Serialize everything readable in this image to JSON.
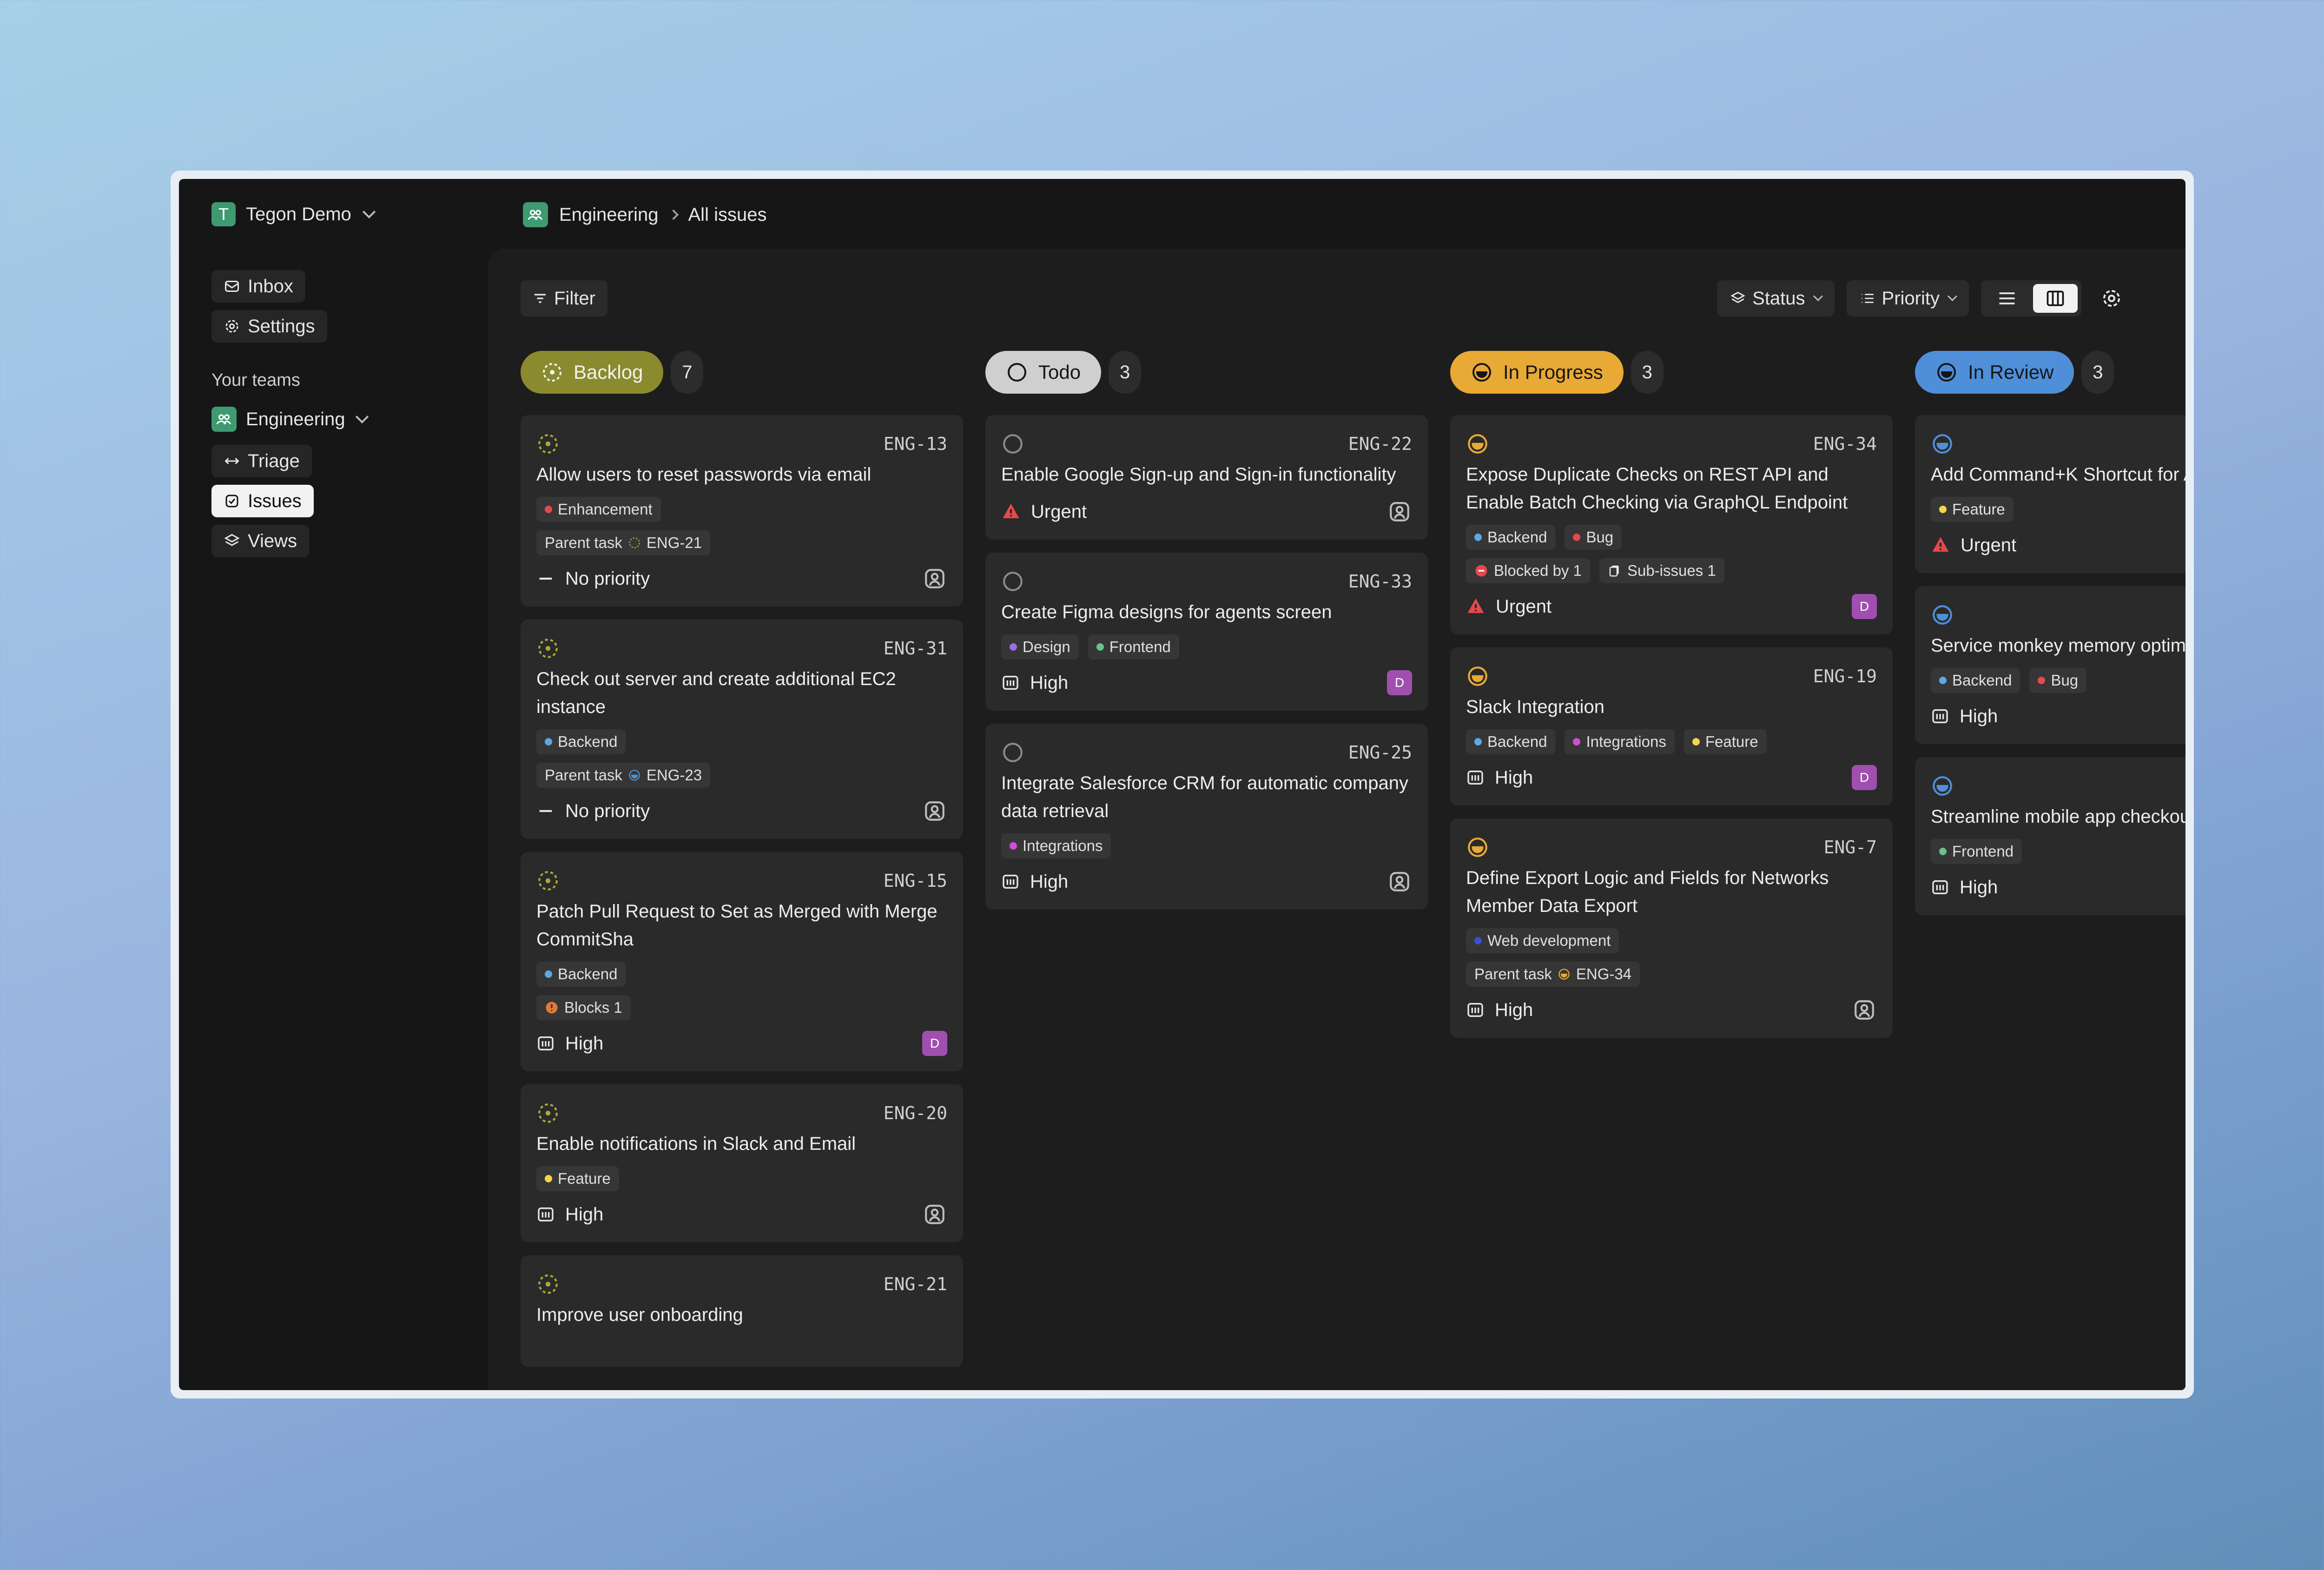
{
  "workspace": {
    "name": "Tegon Demo",
    "initial": "T"
  },
  "nav": {
    "inbox": "Inbox",
    "settings": "Settings"
  },
  "teams": {
    "label": "Your teams",
    "team_name": "Engineering",
    "items": [
      {
        "label": "Triage",
        "icon": "triage-icon"
      },
      {
        "label": "Issues",
        "icon": "issues-icon",
        "active": true
      },
      {
        "label": "Views",
        "icon": "views-icon"
      }
    ]
  },
  "breadcrumb": {
    "team": "Engineering",
    "page": "All issues"
  },
  "toolbar": {
    "filter": "Filter",
    "group_by": "Status",
    "order_by": "Priority",
    "active_view": "board"
  },
  "colors": {
    "backlog": "#a9a93a",
    "todo": "#cfcfcf",
    "in_progress": "#e8a935",
    "in_review": "#4f8fd9",
    "assignee": "#a04fb0",
    "urgent": "#e5484d"
  },
  "columns": [
    {
      "status": "Backlog",
      "count": "7",
      "cards": [
        {
          "id": "ENG-13",
          "title": "Allow users to reset passwords via email",
          "labels": [
            {
              "name": "Enhancement",
              "color": "#e5484d"
            }
          ],
          "relation": {
            "text": "Parent task",
            "ref": "ENG-21"
          },
          "priority": "No priority",
          "assignee": ""
        },
        {
          "id": "ENG-31",
          "title": "Check out server and create additional EC2 instance",
          "labels": [
            {
              "name": "Backend",
              "color": "#5aa9e6"
            }
          ],
          "relation": {
            "text": "Parent task",
            "ref": "ENG-23"
          },
          "priority": "No priority",
          "assignee": ""
        },
        {
          "id": "ENG-15",
          "title": "Patch Pull Request to Set as Merged with Merge CommitSha",
          "labels": [
            {
              "name": "Backend",
              "color": "#5aa9e6"
            }
          ],
          "relation": {
            "text": "Blocks 1"
          },
          "priority": "High",
          "assignee": "D"
        },
        {
          "id": "ENG-20",
          "title": "Enable notifications in Slack and Email",
          "labels": [
            {
              "name": "Feature",
              "color": "#f5d547"
            }
          ],
          "priority": "High",
          "assignee": ""
        },
        {
          "id": "ENG-21",
          "title": "Improve user onboarding"
        }
      ]
    },
    {
      "status": "Todo",
      "count": "3",
      "cards": [
        {
          "id": "ENG-22",
          "title": "Enable Google Sign-up and Sign-in functionality",
          "labels": [],
          "priority": "Urgent",
          "assignee": ""
        },
        {
          "id": "ENG-33",
          "title": "Create Figma designs for agents screen",
          "labels": [
            {
              "name": "Design",
              "color": "#9a6ee8"
            },
            {
              "name": "Frontend",
              "color": "#6cc08b"
            }
          ],
          "priority": "High",
          "assignee": "D"
        },
        {
          "id": "ENG-25",
          "title": "Integrate Salesforce CRM for automatic company data retrieval",
          "labels": [
            {
              "name": "Integrations",
              "color": "#d04fd6"
            }
          ],
          "priority": "High",
          "assignee": ""
        }
      ]
    },
    {
      "status": "In Progress",
      "count": "3",
      "cards": [
        {
          "id": "ENG-34",
          "title": "Expose Duplicate Checks on REST API and Enable Batch Checking via GraphQL Endpoint",
          "labels": [
            {
              "name": "Backend",
              "color": "#5aa9e6"
            },
            {
              "name": "Bug",
              "color": "#e5484d"
            }
          ],
          "relations": [
            {
              "text": "Blocked by 1"
            },
            {
              "text": "Sub-issues 1"
            }
          ],
          "priority": "Urgent",
          "assignee": "D"
        },
        {
          "id": "ENG-19",
          "title": "Slack Integration",
          "labels": [
            {
              "name": "Backend",
              "color": "#5aa9e6"
            },
            {
              "name": "Integrations",
              "color": "#d04fd6"
            },
            {
              "name": "Feature",
              "color": "#f5d547"
            }
          ],
          "priority": "High",
          "assignee": "D"
        },
        {
          "id": "ENG-7",
          "title": "Define Export Logic and Fields for Networks Member Data Export",
          "labels": [
            {
              "name": "Web development",
              "color": "#3b4fd6"
            }
          ],
          "relation": {
            "text": "Parent task",
            "ref": "ENG-34"
          },
          "priority": "High",
          "assignee": ""
        }
      ]
    },
    {
      "status": "In Review",
      "count": "3",
      "cards": [
        {
          "id": "",
          "title": "Add Command+K Shortcut for App",
          "labels": [
            {
              "name": "Feature",
              "color": "#f5d547"
            }
          ],
          "priority": "Urgent",
          "assignee": ""
        },
        {
          "id": "",
          "title": "Service monkey memory optimization usage",
          "labels": [
            {
              "name": "Backend",
              "color": "#5aa9e6"
            },
            {
              "name": "Bug",
              "color": "#e5484d"
            }
          ],
          "priority": "High",
          "assignee": ""
        },
        {
          "id": "",
          "title": "Streamline mobile app checkout",
          "labels": [
            {
              "name": "Frontend",
              "color": "#6cc08b"
            }
          ],
          "priority": "High",
          "assignee": ""
        }
      ]
    }
  ]
}
